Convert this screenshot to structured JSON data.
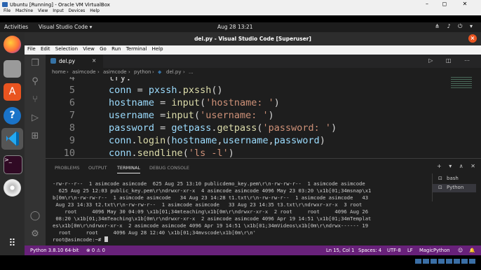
{
  "vbox": {
    "title": "Ubuntu [Running] - Oracle VM VirtualBox",
    "menu": [
      "File",
      "Machine",
      "View",
      "Input",
      "Devices",
      "Help"
    ],
    "window_controls": [
      "–",
      "◻",
      "✕"
    ]
  },
  "topbar": {
    "activities": "Activities",
    "app_menu": "Visual Studio Code ▾",
    "clock": "Aug 28  13:21",
    "tray": "⋔ ♪ ⏻ ▾"
  },
  "vscode": {
    "title": "del.py - Visual Studio Code [Superuser]",
    "menu": [
      "File",
      "Edit",
      "Selection",
      "View",
      "Go",
      "Run",
      "Terminal",
      "Help"
    ],
    "tab": {
      "label": "del.py",
      "close": "×"
    },
    "editor_actions": "▷ ◫ ⋯",
    "breadcrumb": [
      "home",
      "asimcode",
      "asimcode",
      "python",
      "del.py",
      "..."
    ],
    "breadcrumb_separator": "›",
    "code_lines": [
      {
        "num": "4",
        "tokens": [
          {
            "t": "try:",
            "c": "pl"
          }
        ]
      },
      {
        "num": "5",
        "tokens": [
          {
            "t": "conn",
            "c": "var"
          },
          {
            "t": " = ",
            "c": "pl"
          },
          {
            "t": "pxssh",
            "c": "var"
          },
          {
            "t": ".",
            "c": "pl"
          },
          {
            "t": "pxssh",
            "c": "fn"
          },
          {
            "t": "()",
            "c": "pl"
          }
        ]
      },
      {
        "num": "6",
        "tokens": [
          {
            "t": "hostname",
            "c": "var"
          },
          {
            "t": " = ",
            "c": "pl"
          },
          {
            "t": "input",
            "c": "fn"
          },
          {
            "t": "(",
            "c": "pl"
          },
          {
            "t": "'hostname: '",
            "c": "str"
          },
          {
            "t": ")",
            "c": "pl"
          }
        ]
      },
      {
        "num": "7",
        "tokens": [
          {
            "t": "username",
            "c": "var"
          },
          {
            "t": " =",
            "c": "pl"
          },
          {
            "t": "input",
            "c": "fn"
          },
          {
            "t": "(",
            "c": "pl"
          },
          {
            "t": "'username: '",
            "c": "str"
          },
          {
            "t": ")",
            "c": "pl"
          }
        ]
      },
      {
        "num": "8",
        "tokens": [
          {
            "t": "password",
            "c": "var"
          },
          {
            "t": " = ",
            "c": "pl"
          },
          {
            "t": "getpass",
            "c": "var"
          },
          {
            "t": ".",
            "c": "pl"
          },
          {
            "t": "getpass",
            "c": "fn"
          },
          {
            "t": "(",
            "c": "pl"
          },
          {
            "t": "'password: '",
            "c": "str"
          },
          {
            "t": ")",
            "c": "pl"
          }
        ]
      },
      {
        "num": "9",
        "tokens": [
          {
            "t": "conn",
            "c": "var"
          },
          {
            "t": ".",
            "c": "pl"
          },
          {
            "t": "login",
            "c": "fn"
          },
          {
            "t": "(",
            "c": "pl"
          },
          {
            "t": "hostname",
            "c": "var"
          },
          {
            "t": ",",
            "c": "pl"
          },
          {
            "t": "username",
            "c": "var"
          },
          {
            "t": ",",
            "c": "pl"
          },
          {
            "t": "password",
            "c": "var"
          },
          {
            "t": ")",
            "c": "pl"
          }
        ]
      },
      {
        "num": "10",
        "tokens": [
          {
            "t": "conn",
            "c": "var"
          },
          {
            "t": ".",
            "c": "pl"
          },
          {
            "t": "sendline",
            "c": "fn"
          },
          {
            "t": "(",
            "c": "pl"
          },
          {
            "t": "'ls -l'",
            "c": "str"
          },
          {
            "t": ")",
            "c": "pl"
          }
        ]
      }
    ]
  },
  "panel": {
    "tabs": [
      "PROBLEMS",
      "OUTPUT",
      "TERMINAL",
      "DEBUG CONSOLE"
    ],
    "actions": "+ ▾ ∧ ✕",
    "terminal_lines": [
      "-rw-r--r--  1 asimcode asimcode  625 Aug 25 13:10 publicdemo_key.pem\\r\\n-rw-rw-r--  1 asimcode asimcode",
      "  625 Aug 25 12:03 public_key.pem\\r\\ndrwxr-xr-x  4 asimcode asimcode 4096 May 23 03:20 \\x1b[01;34msnap\\x1",
      "b[0m\\r\\n-rw-rw-r--  1 asimcode asimcode   34 Aug 23 14:28 t1.txt\\r\\n-rw-rw-r--  1 asimcode asimcode   43",
      " Aug 23 14:33 t2.txt\\r\\n-rw-rw-r--  1 asimcode asimcode   33 Aug 23 14:35 t3.txt\\r\\ndrwxr-xr-x  3 root",
      "    root     4096 May 30 04:09 \\x1b[01;34mteaching\\x1b[0m\\r\\ndrwxr-xr-x  2 root     root     4096 Aug 26",
      " 08:20 \\x1b[01;34mTeaching\\x1b[0m\\r\\ndrwxr-xr-x  2 asimcode asimcode 4096 Apr 19 14:51 \\x1b[01;34mTemplat",
      "es\\x1b[0m\\r\\ndrwxr-xr-x  2 asimcode asimcode 4096 Apr 19 14:51 \\x1b[01;34mVideos\\x1b[0m\\r\\ndrwx------ 19",
      "  root     root     4096 Aug 28 12:40 \\x1b[01;34mvscode\\x1b[0m\\r\\n'",
      "root@asimcode:~# "
    ],
    "terminals": [
      {
        "icon": "⊡",
        "label": "bash"
      },
      {
        "icon": "⊡",
        "label": "Python"
      }
    ]
  },
  "statusbar": {
    "interpreter": "Python 3.8.10 64-bit",
    "problems": "⊗ 0 ⚠ 0",
    "position": "Ln 15, Col 1",
    "spaces": "Spaces: 4",
    "encoding": "UTF-8",
    "eol": "LF",
    "language": "MagicPython",
    "feedback": "☺",
    "notifications": "🔔"
  },
  "colors": {
    "statusbar": "#68217a",
    "ubuntu_accent": "#e95420",
    "editor_bg": "#1e1e1e"
  },
  "icons": {
    "dock": [
      "firefox-icon",
      "files-icon",
      "software-icon",
      "help-icon",
      "vscode-icon",
      "terminal-icon",
      "dvd-icon",
      "apps-grid-icon"
    ],
    "activitybar": [
      "explorer-icon",
      "search-icon",
      "source-control-icon",
      "run-debug-icon",
      "extensions-icon",
      "account-icon",
      "settings-icon"
    ]
  }
}
